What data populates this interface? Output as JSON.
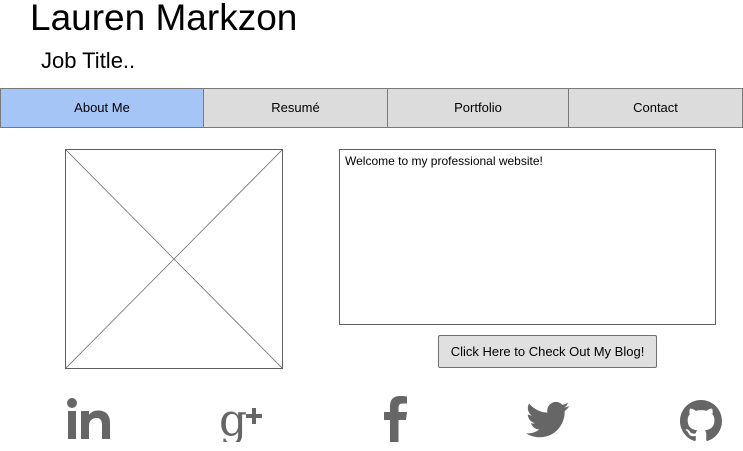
{
  "header": {
    "name": "Lauren Markzon",
    "job_title": "Job Title.."
  },
  "nav": {
    "tabs": [
      {
        "label": "About Me",
        "active": true
      },
      {
        "label": "Resumé",
        "active": false
      },
      {
        "label": "Portfolio",
        "active": false
      },
      {
        "label": "Contact",
        "active": false
      }
    ]
  },
  "main": {
    "photo_icon": "image-placeholder-icon",
    "welcome_text": "Welcome to my professional website!",
    "blog_button_label": "Click Here to Check Out My Blog!"
  },
  "social": {
    "icons": [
      "linkedin-icon",
      "google-plus-icon",
      "facebook-icon",
      "twitter-icon",
      "github-icon"
    ],
    "color": "#666666"
  },
  "colors": {
    "active_tab": "#a6c5f7",
    "tab_bg": "#dcdcdc"
  }
}
